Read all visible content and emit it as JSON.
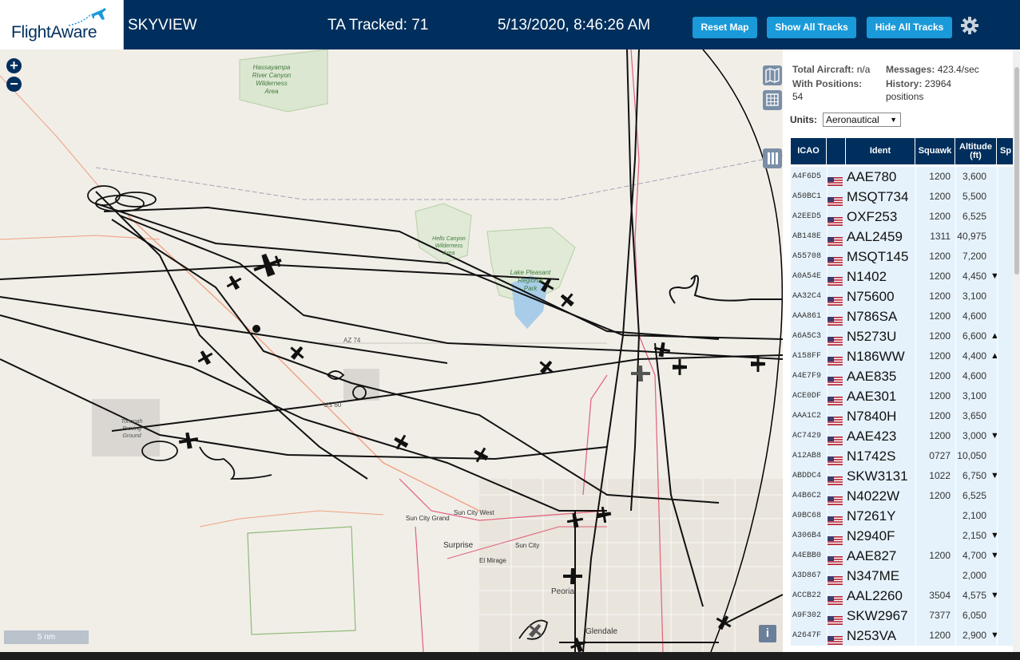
{
  "header": {
    "logo": "FlightAware",
    "app_name": "SKYVIEW",
    "tracked": "TA Tracked: 71",
    "datetime": "5/13/2020, 8:46:26 AM",
    "buttons": [
      "Reset Map",
      "Show All Tracks",
      "Hide All Tracks"
    ],
    "settings_icon": "gear-icon"
  },
  "map": {
    "zoom_in": "+",
    "zoom_out": "−",
    "scale": "5 nm",
    "info": "i",
    "labels": {
      "hassayampa": [
        "Hassayampa",
        "River Canyon",
        "Wilderness",
        "Area"
      ],
      "hells_canyon": [
        "Hells Canyon",
        "Wilderness",
        "Area"
      ],
      "lake_pleasant": [
        "Lake Pleasant",
        "Regional",
        "Park"
      ],
      "az74": "AZ 74",
      "us60": "US 60",
      "sun_city_west": "Sun City West",
      "sun_city_grand": "Sun City Grand",
      "surprise": "Surprise",
      "sun_city": "Sun City",
      "el_mirage": "El Mirage",
      "peoria": "Peoria",
      "glendale": "Glendale",
      "tonopah": [
        "Tonopah",
        "Proving",
        "Ground"
      ]
    }
  },
  "stats": {
    "total_aircraft_label": "Total Aircraft:",
    "total_aircraft_value": "n/a",
    "messages_label": "Messages:",
    "messages_value": "423.4/sec",
    "with_positions_label": "With Positions:",
    "with_positions_value": "54",
    "history_label": "History:",
    "history_value": "23964",
    "history_unit": "positions"
  },
  "units": {
    "label": "Units:",
    "value": "Aeronautical"
  },
  "table": {
    "columns": [
      "ICAO",
      "",
      "Ident",
      "Squawk",
      "Altitude (ft)",
      "Sp"
    ],
    "rows": [
      {
        "icao": "A4F6D5",
        "ident": "AAE780",
        "squawk": "1200",
        "alt": "3,600",
        "trend": ""
      },
      {
        "icao": "A50BC1",
        "ident": "MSQT734",
        "squawk": "1200",
        "alt": "5,500",
        "trend": ""
      },
      {
        "icao": "A2EED5",
        "ident": "OXF253",
        "squawk": "1200",
        "alt": "6,525",
        "trend": ""
      },
      {
        "icao": "AB148E",
        "ident": "AAL2459",
        "squawk": "1311",
        "alt": "40,975",
        "trend": ""
      },
      {
        "icao": "A55708",
        "ident": "MSQT145",
        "squawk": "1200",
        "alt": "7,200",
        "trend": ""
      },
      {
        "icao": "A0A54E",
        "ident": "N1402",
        "squawk": "1200",
        "alt": "4,450",
        "trend": "▼"
      },
      {
        "icao": "AA32C4",
        "ident": "N75600",
        "squawk": "1200",
        "alt": "3,100",
        "trend": ""
      },
      {
        "icao": "AAA861",
        "ident": "N786SA",
        "squawk": "1200",
        "alt": "4,600",
        "trend": ""
      },
      {
        "icao": "A6A5C3",
        "ident": "N5273U",
        "squawk": "1200",
        "alt": "6,600",
        "trend": "▲"
      },
      {
        "icao": "A158FF",
        "ident": "N186WW",
        "squawk": "1200",
        "alt": "4,400",
        "trend": "▲"
      },
      {
        "icao": "A4E7F9",
        "ident": "AAE835",
        "squawk": "1200",
        "alt": "4,600",
        "trend": ""
      },
      {
        "icao": "ACE0DF",
        "ident": "AAE301",
        "squawk": "1200",
        "alt": "3,100",
        "trend": ""
      },
      {
        "icao": "AAA1C2",
        "ident": "N7840H",
        "squawk": "1200",
        "alt": "3,650",
        "trend": ""
      },
      {
        "icao": "AC7429",
        "ident": "AAE423",
        "squawk": "1200",
        "alt": "3,000",
        "trend": "▼"
      },
      {
        "icao": "A12AB8",
        "ident": "N1742S",
        "squawk": "0727",
        "alt": "10,050",
        "trend": ""
      },
      {
        "icao": "ABDDC4",
        "ident": "SKW3131",
        "squawk": "1022",
        "alt": "6,750",
        "trend": "▼"
      },
      {
        "icao": "A4B6C2",
        "ident": "N4022W",
        "squawk": "1200",
        "alt": "6,525",
        "trend": ""
      },
      {
        "icao": "A9BC68",
        "ident": "N7261Y",
        "squawk": "",
        "alt": "2,100",
        "trend": ""
      },
      {
        "icao": "A306B4",
        "ident": "N2940F",
        "squawk": "",
        "alt": "2,150",
        "trend": "▼"
      },
      {
        "icao": "A4EBB0",
        "ident": "AAE827",
        "squawk": "1200",
        "alt": "4,700",
        "trend": "▼"
      },
      {
        "icao": "A3D867",
        "ident": "N347ME",
        "squawk": "",
        "alt": "2,000",
        "trend": ""
      },
      {
        "icao": "ACCB22",
        "ident": "AAL2260",
        "squawk": "3504",
        "alt": "4,575",
        "trend": "▼"
      },
      {
        "icao": "A9F302",
        "ident": "SKW2967",
        "squawk": "7377",
        "alt": "6,050",
        "trend": ""
      },
      {
        "icao": "A2647F",
        "ident": "N253VA",
        "squawk": "1200",
        "alt": "2,900",
        "trend": "▼"
      }
    ]
  },
  "colors": {
    "header_bg": "#002f5d",
    "button": "#1a9ad9",
    "row_bg": "#e6f2fb"
  }
}
